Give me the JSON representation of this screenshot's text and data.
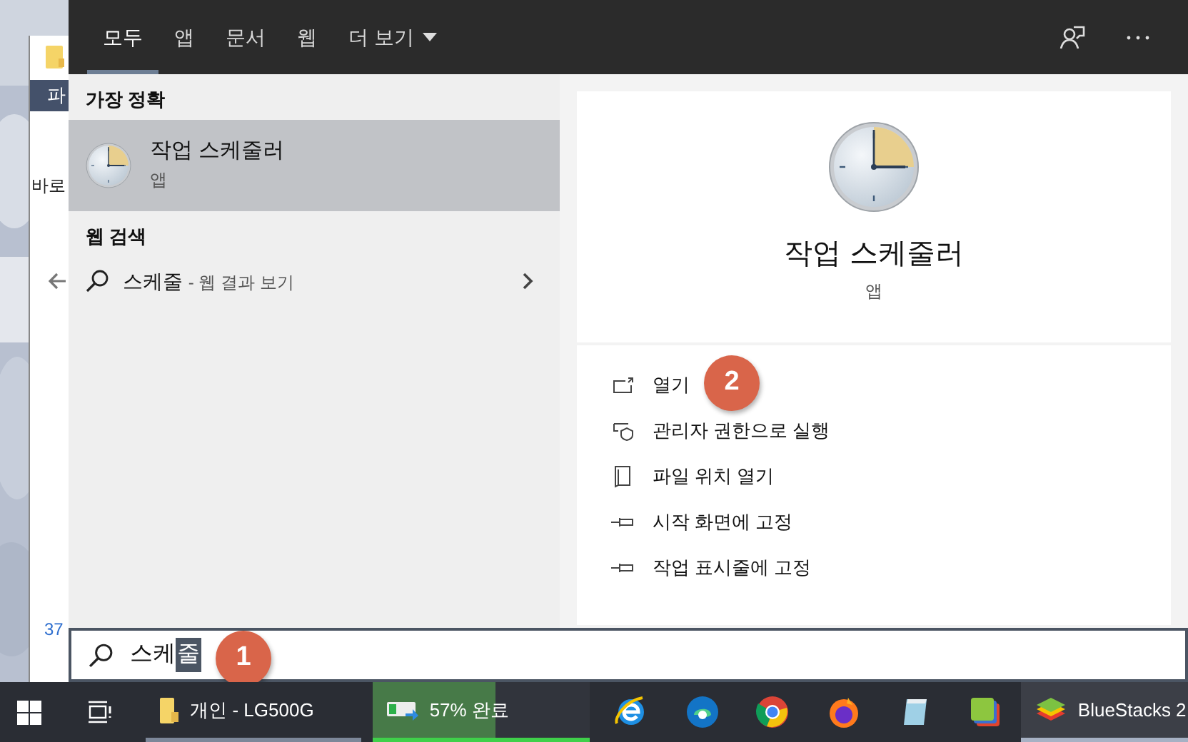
{
  "background_window": {
    "ribbon_tab": "파",
    "nav_text": "바로",
    "status_text": "37"
  },
  "search_panel": {
    "tabs": [
      {
        "label": "모두",
        "selected": true
      },
      {
        "label": "앱",
        "selected": false
      },
      {
        "label": "문서",
        "selected": false
      },
      {
        "label": "웹",
        "selected": false
      },
      {
        "label": "더 보기",
        "selected": false,
        "dropdown": true
      }
    ],
    "best_match": {
      "heading": "가장 정확",
      "name": "작업 스케줄러",
      "type": "앱",
      "selected": true
    },
    "web_search": {
      "heading": "웹 검색",
      "query": "스케줄",
      "suffix": "- 웹 결과 보기"
    },
    "detail": {
      "name": "작업 스케줄러",
      "type": "앱",
      "actions": [
        {
          "kind": "open",
          "label": "열기"
        },
        {
          "kind": "admin",
          "label": "관리자 권한으로 실행"
        },
        {
          "kind": "folder",
          "label": "파일 위치 열기"
        },
        {
          "kind": "pin",
          "label": "시작 화면에 고정"
        },
        {
          "kind": "pin",
          "label": "작업 표시줄에 고정"
        }
      ]
    },
    "search_box": {
      "value": "스케",
      "selected_text": "줄"
    }
  },
  "annotations": [
    {
      "label": "1"
    },
    {
      "label": "2"
    }
  ],
  "taskbar": {
    "windows": [
      {
        "kind": "window",
        "label": "개인 - LG500G",
        "active": false
      },
      {
        "kind": "progress",
        "label": "57% 완료",
        "level": 0.57
      },
      {
        "kind": "window",
        "label": "BlueStacks 2",
        "active": true
      }
    ]
  }
}
